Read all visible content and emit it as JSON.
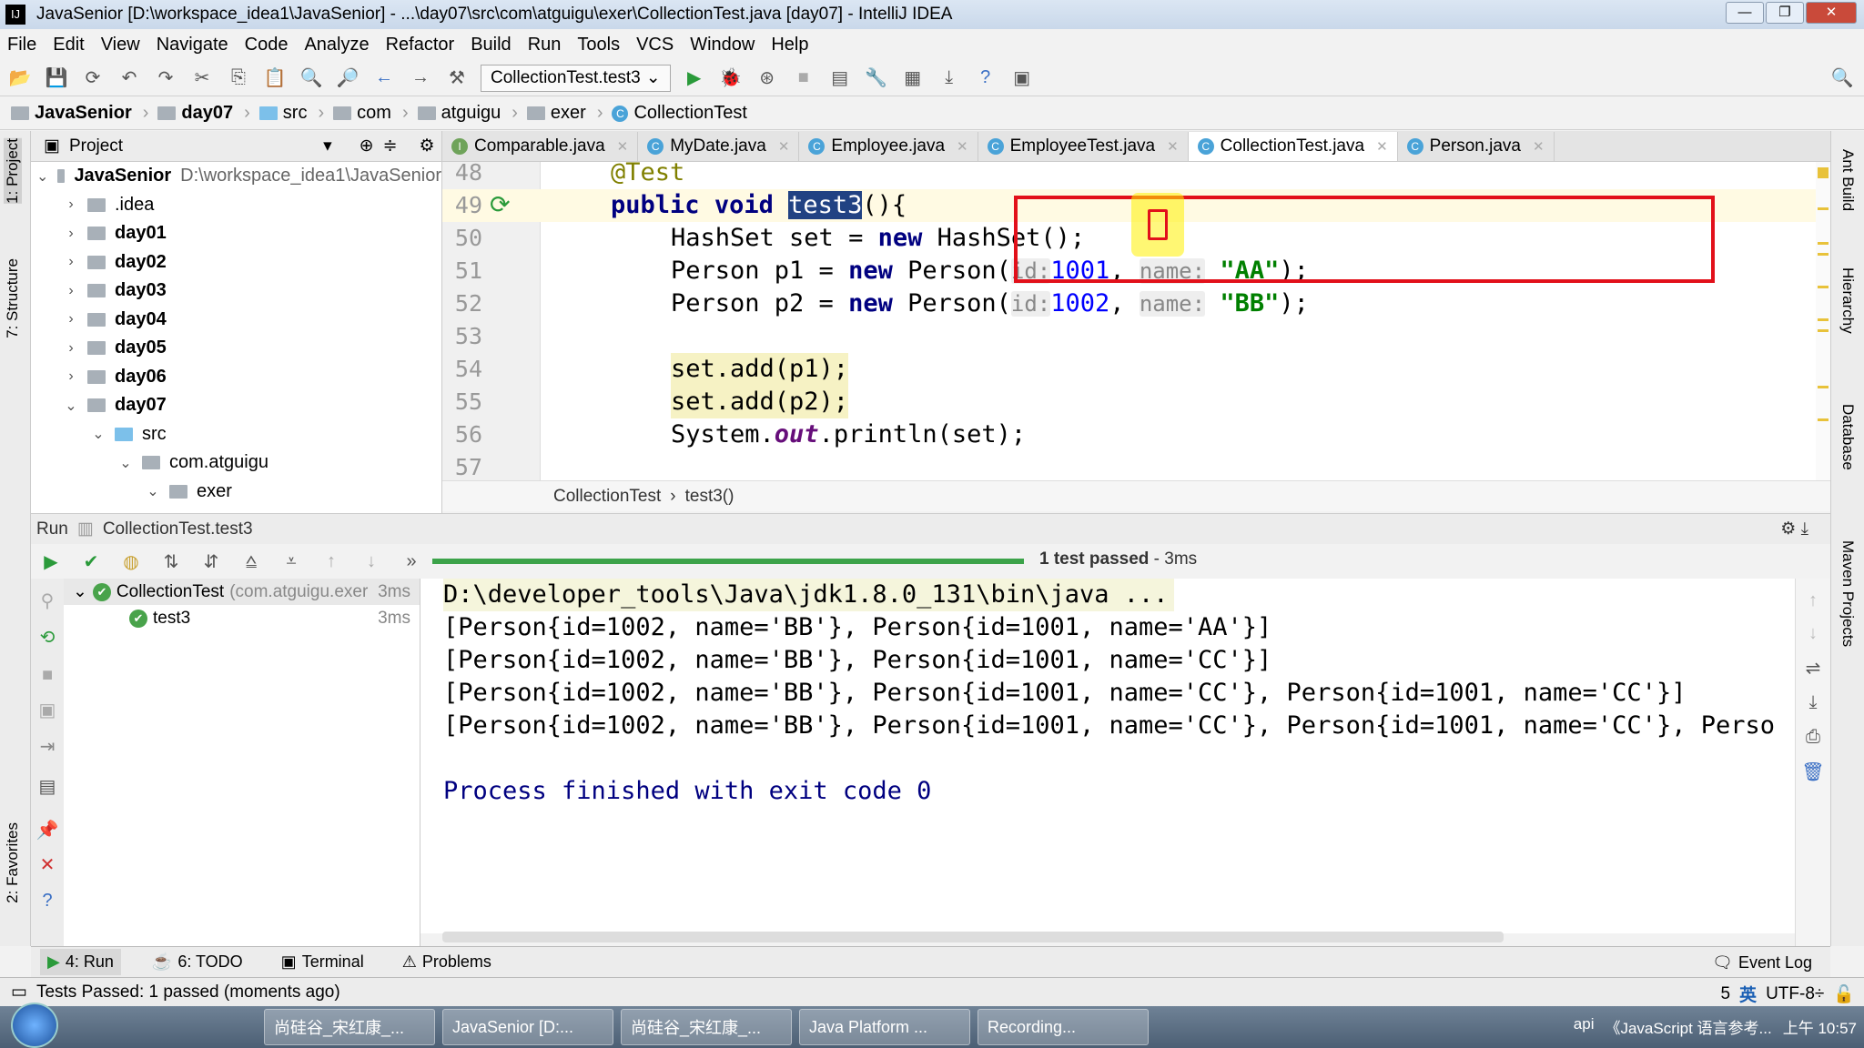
{
  "window": {
    "title": "JavaSenior [D:\\workspace_idea1\\JavaSenior] - ...\\day07\\src\\com\\atguigu\\exer\\CollectionTest.java [day07] - IntelliJ IDEA",
    "minimize": "—",
    "maximize": "❐",
    "close": "✕"
  },
  "menu": [
    "File",
    "Edit",
    "View",
    "Navigate",
    "Code",
    "Analyze",
    "Refactor",
    "Build",
    "Run",
    "Tools",
    "VCS",
    "Window",
    "Help"
  ],
  "toolbar": {
    "run_config": "CollectionTest.test3"
  },
  "breadcrumb": [
    "JavaSenior",
    "day07",
    "src",
    "com",
    "atguigu",
    "exer",
    "CollectionTest"
  ],
  "project": {
    "title": "Project",
    "root": {
      "name": "JavaSenior",
      "path": "D:\\workspace_idea1\\JavaSenior"
    },
    "items": [
      {
        "name": ".idea",
        "depth": 1,
        "open": false,
        "bold": false
      },
      {
        "name": "day01",
        "depth": 1,
        "open": false,
        "bold": true
      },
      {
        "name": "day02",
        "depth": 1,
        "open": false,
        "bold": true
      },
      {
        "name": "day03",
        "depth": 1,
        "open": false,
        "bold": true
      },
      {
        "name": "day04",
        "depth": 1,
        "open": false,
        "bold": true
      },
      {
        "name": "day05",
        "depth": 1,
        "open": false,
        "bold": true
      },
      {
        "name": "day06",
        "depth": 1,
        "open": false,
        "bold": true
      },
      {
        "name": "day07",
        "depth": 1,
        "open": true,
        "bold": true
      },
      {
        "name": "src",
        "depth": 2,
        "open": true,
        "bold": false
      },
      {
        "name": "com.atguigu",
        "depth": 3,
        "open": true,
        "bold": false
      },
      {
        "name": "exer",
        "depth": 4,
        "open": true,
        "bold": false
      }
    ]
  },
  "left_stripe": {
    "project": "1: Project",
    "structure": "7: Structure",
    "favorites": "2: Favorites"
  },
  "right_stripe": [
    "Ant Build",
    "Hierarchy",
    "Database",
    "Maven Projects"
  ],
  "tabs": [
    {
      "label": "Comparable.java",
      "active": false
    },
    {
      "label": "MyDate.java",
      "active": false
    },
    {
      "label": "Employee.java",
      "active": false
    },
    {
      "label": "EmployeeTest.java",
      "active": false
    },
    {
      "label": "CollectionTest.java",
      "active": true
    },
    {
      "label": "Person.java",
      "active": false
    }
  ],
  "code": {
    "line_numbers": [
      "48",
      "49",
      "50",
      "51",
      "52",
      "53",
      "54",
      "55",
      "56",
      "57"
    ],
    "l48": "@Test",
    "l49": {
      "kw1": "public",
      "kw2": "void",
      "name": "test3",
      "rest": "(){"
    },
    "l50": {
      "a": "HashSet set = ",
      "kw": "new",
      "b": " HashSet();"
    },
    "l51": {
      "a": "Person p1 = ",
      "kw": "new",
      "b": " Person(",
      "h1": "id:",
      "v1": "1001",
      ", ": ", ",
      "h2": "name:",
      "v2": "\"AA\"",
      "end": ");"
    },
    "l52": {
      "a": "Person p2 = ",
      "kw": "new",
      "b": " Person(",
      "h1": "id:",
      "v1": "1002",
      "h2": "name:",
      "v2": "\"BB\"",
      "end": ");"
    },
    "l54": "set.add(p1);",
    "l55": "set.add(p2);",
    "l56": {
      "a": "System.",
      "out": "out",
      "b": ".println(set);"
    }
  },
  "editor_crumb": {
    "cls": "CollectionTest",
    "method": "test3()"
  },
  "run": {
    "label": "Run",
    "config": "CollectionTest.test3",
    "status": "1 test passed",
    "duration": " - 3ms",
    "progress_percent": 100,
    "tree": [
      {
        "name": "CollectionTest",
        "detail": "(com.atguigu.exer",
        "time": "3ms"
      },
      {
        "name": "test3",
        "time": "3ms"
      }
    ],
    "console": [
      "D:\\developer_tools\\Java\\jdk1.8.0_131\\bin\\java ...",
      "[Person{id=1002, name='BB'}, Person{id=1001, name='AA'}]",
      "[Person{id=1002, name='BB'}, Person{id=1001, name='CC'}]",
      "[Person{id=1002, name='BB'}, Person{id=1001, name='CC'}, Person{id=1001, name='CC'}]",
      "[Person{id=1002, name='BB'}, Person{id=1001, name='CC'}, Person{id=1001, name='CC'}, Perso",
      "",
      "Process finished with exit code 0"
    ]
  },
  "bottom_tabs": [
    {
      "label": "4: Run",
      "active": true
    },
    {
      "label": "6: TODO",
      "active": false
    },
    {
      "label": "Terminal",
      "active": false
    },
    {
      "label": "Problems",
      "active": false
    }
  ],
  "event_log": "Event Log",
  "status": {
    "message": "Tests Passed: 1 passed (moments ago)",
    "right": "5",
    "encoding": "UTF-8÷",
    "ime": "英"
  },
  "taskbar": {
    "items": [
      "尚硅谷_宋红康_...",
      "JavaSenior [D:...",
      "尚硅谷_宋红康_...",
      "Java Platform ...",
      "Recording..."
    ],
    "extra": "api",
    "js_ref": "《JavaScript 语言参考...",
    "clock": "上午 10:57"
  },
  "colors": {
    "accent_red": "#e2101a",
    "progress_green": "#3ca34a",
    "keyword": "#000080",
    "string": "#008000"
  }
}
